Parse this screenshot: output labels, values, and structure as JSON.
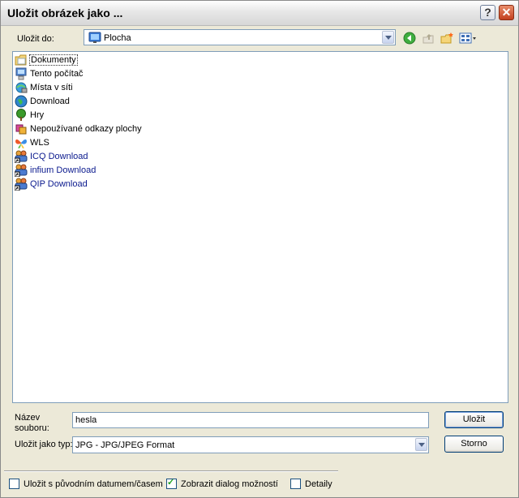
{
  "window": {
    "title": "Uložit obrázek jako ..."
  },
  "titlebar": {
    "help_glyph": "?",
    "close_glyph": "✕"
  },
  "toolbar": {
    "save_in_label": "Uložit do:",
    "location": "Plocha"
  },
  "files": [
    {
      "name": "Dokumenty",
      "icon": "documents-folder-icon",
      "selected": true,
      "link": false
    },
    {
      "name": "Tento počítač",
      "icon": "my-computer-icon",
      "link": false
    },
    {
      "name": "Místa v síti",
      "icon": "network-places-icon",
      "link": false
    },
    {
      "name": "Download",
      "icon": "globe-folder-icon",
      "link": false
    },
    {
      "name": "Hry",
      "icon": "tree-icon",
      "link": false
    },
    {
      "name": "Nepoužívané odkazy plochy",
      "icon": "unused-shortcuts-icon",
      "link": false
    },
    {
      "name": "WLS",
      "icon": "butterfly-icon",
      "link": false
    },
    {
      "name": "ICQ Download",
      "icon": "users-shortcut-icon",
      "link": true
    },
    {
      "name": "infium Download",
      "icon": "users-shortcut-icon",
      "link": true
    },
    {
      "name": "QIP Download",
      "icon": "users-shortcut-icon",
      "link": true
    }
  ],
  "form": {
    "filename_label_line1": "Název",
    "filename_label_line2": "souboru:",
    "filename_value": "hesla",
    "filetype_label": "Uložit jako typ:",
    "filetype_value": "JPG - JPG/JPEG Format"
  },
  "buttons": {
    "save": "Uložit",
    "cancel": "Storno"
  },
  "options": {
    "keep_date": {
      "label": "Uložit s původním datumem/časem",
      "checked": false
    },
    "show_options": {
      "label": "Zobrazit dialog možností",
      "checked": true
    },
    "details": {
      "label": "Detaily",
      "checked": false
    }
  }
}
